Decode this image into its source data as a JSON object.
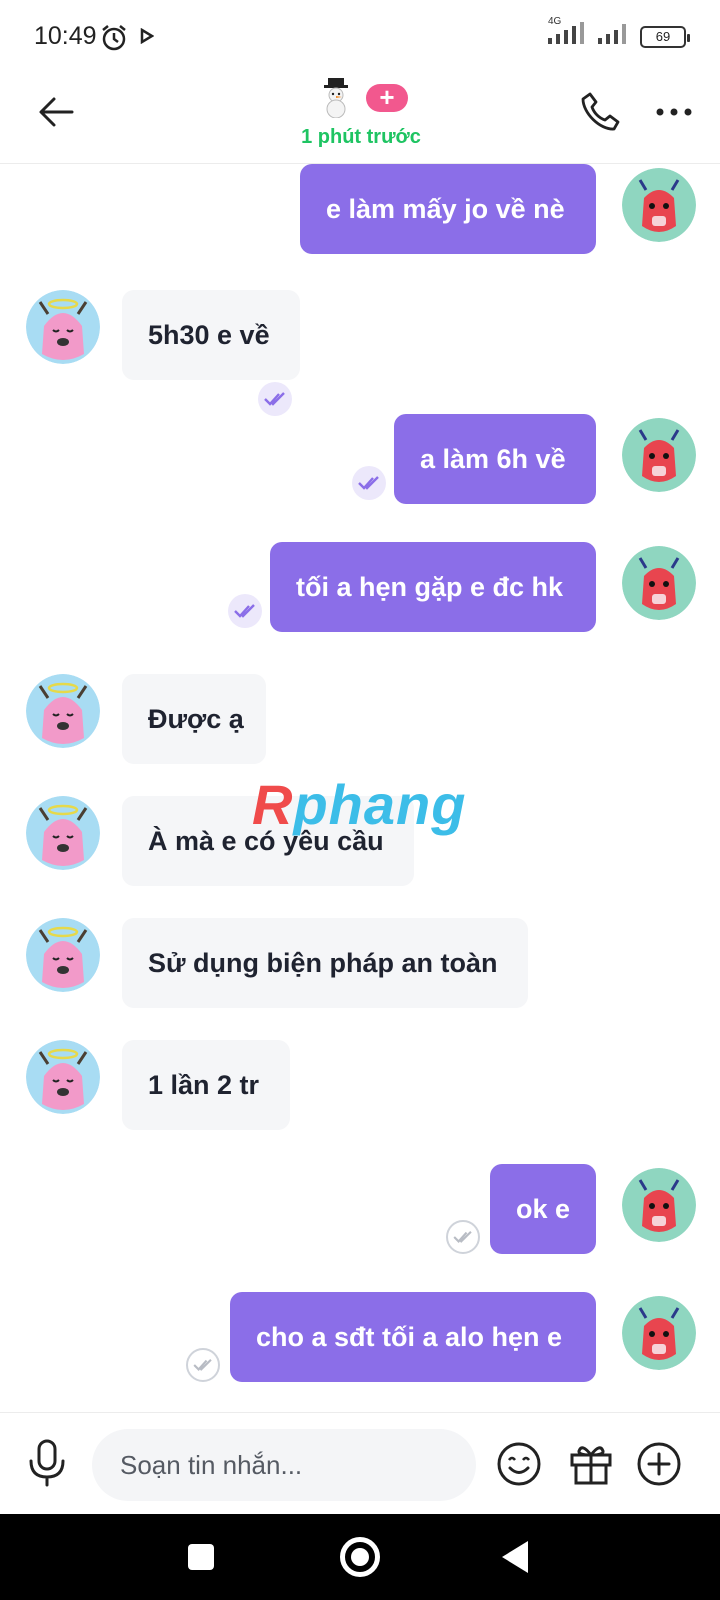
{
  "status_bar": {
    "time": "10:49",
    "network": "4G",
    "battery": "69",
    "icons": [
      "alarm-icon",
      "play-icon",
      "signal-icon",
      "battery-icon"
    ]
  },
  "header": {
    "back_icon": "arrow-left-icon",
    "contact_icon": "snowman-icon",
    "badge": "+",
    "last_seen": "1 phút trước",
    "last_seen_color": "#1ec462",
    "call_icon": "phone-icon",
    "more_icon": "more-dots-icon"
  },
  "colors": {
    "outgoing_bubble": "#8b6ee8",
    "incoming_bubble": "#f5f6f8",
    "badge": "#f2588e"
  },
  "messages": [
    {
      "direction": "out",
      "text": "e làm mấy jo về nè",
      "status": "read"
    },
    {
      "direction": "in",
      "text": "5h30 e về"
    },
    {
      "direction": "out",
      "text": "a làm 6h về",
      "status": "read"
    },
    {
      "direction": "out",
      "text": "tối a hẹn gặp e đc hk",
      "status": "read"
    },
    {
      "direction": "in",
      "text": "Được ạ"
    },
    {
      "direction": "in",
      "text": "À mà e có yêu cầu"
    },
    {
      "direction": "in",
      "text": "Sử dụng biện pháp an toàn"
    },
    {
      "direction": "in",
      "text": "1 lần 2 tr"
    },
    {
      "direction": "out",
      "text": "ok e",
      "status": "sent"
    },
    {
      "direction": "out",
      "text": "cho a sđt tối a alo hẹn e",
      "status": "sent"
    }
  ],
  "watermark": {
    "first": "R",
    "rest": "phang"
  },
  "composer": {
    "placeholder": "Soạn tin nhắn...",
    "mic_icon": "microphone-icon",
    "emoji_icon": "emoji-icon",
    "gift_icon": "gift-icon",
    "add_icon": "plus-circle-icon"
  },
  "nav": {
    "recent_icon": "recent-apps-icon",
    "home_icon": "home-icon",
    "back_icon": "nav-back-icon"
  }
}
